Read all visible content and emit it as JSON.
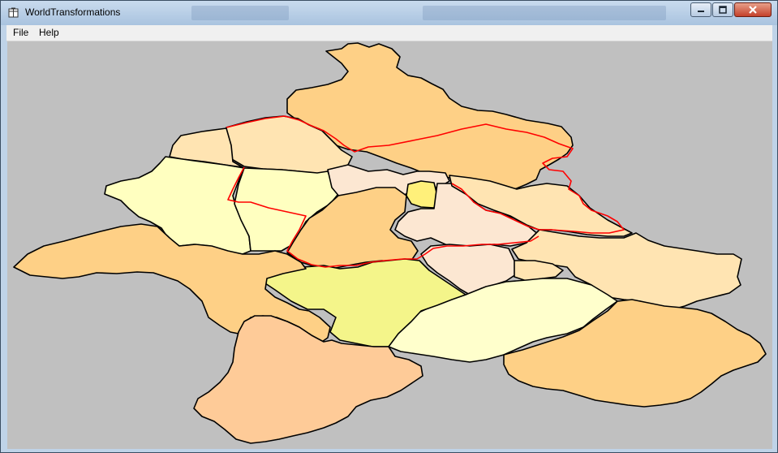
{
  "window": {
    "title": "WorldTransformations"
  },
  "menu": {
    "items": [
      "File",
      "Help"
    ]
  },
  "icons": {
    "app": "app-icon",
    "minimize": "minimize-icon",
    "maximize": "maximize-icon",
    "close": "close-icon"
  },
  "colors": {
    "canvas_background": "#c0c0c0",
    "border": "#000000",
    "highlight_border": "#ff0000",
    "regions": [
      "#fed086",
      "#ffe4b2",
      "#ffffc0",
      "#fce7d2",
      "#fff07a",
      "#f4f58a",
      "#fecb98",
      "#ffffcc"
    ]
  }
}
